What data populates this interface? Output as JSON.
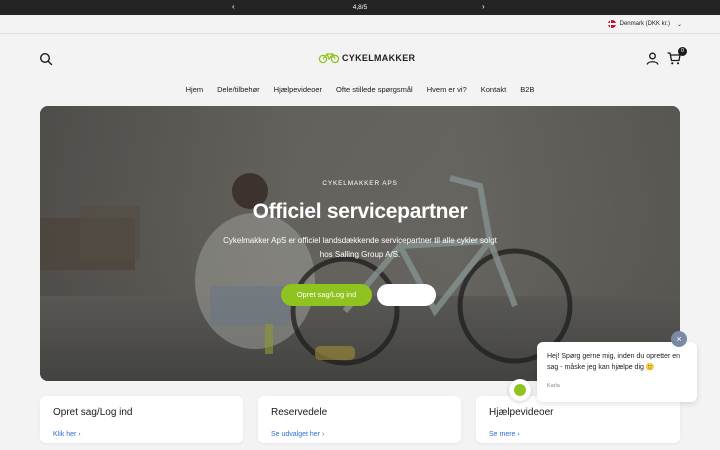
{
  "announcement": {
    "text": "4,8/5",
    "prev": "‹",
    "next": "›"
  },
  "topbar": {
    "currency": "Denmark (DKK kr.)",
    "caret": "⌄"
  },
  "header": {
    "logo_text": "CYKELMAKKER",
    "cart_count": "0"
  },
  "nav": {
    "items": [
      "Hjem",
      "Dele/tilbehør",
      "Hjælpevideoer",
      "Ofte stillede spørgsmål",
      "Hvem er vi?",
      "Kontakt",
      "B2B"
    ]
  },
  "hero": {
    "eyebrow": "CYKELMAKKER APS",
    "title": "Officiel servicepartner",
    "description": "Cykelmakker ApS er officiel landsdækkende servicepartner til alle cykler solgt hos Salling Group A/S.",
    "primary_button": "Opret sag/Log ind",
    "secondary_button": ""
  },
  "cards": [
    {
      "title": "Opret sag/Log ind",
      "link": "Klik her ›"
    },
    {
      "title": "Reservedele",
      "link": "Se udvalget her ›"
    },
    {
      "title": "Hjælpevideoer",
      "link": "Se mere ›"
    }
  ],
  "chat": {
    "message": "Hej! Spørg gerne mig, inden du opretter en sag - måske jeg kan hjælpe dig 🙂",
    "agent": "Karla",
    "close": "×"
  },
  "colors": {
    "accent": "#8fc31f",
    "link": "#2a6fd1",
    "topbar": "#232323"
  }
}
